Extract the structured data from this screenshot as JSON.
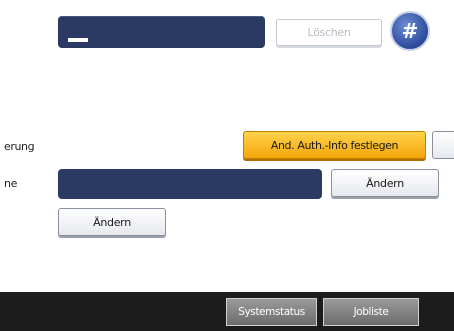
{
  "top": {
    "delete_label": "Löschen",
    "hash_label": "#"
  },
  "labels": {
    "row1": "erung",
    "row2": "ne"
  },
  "actions": {
    "auth_info_label": "And. Auth.-Info festlegen",
    "change_right_label": "Ändern",
    "change_left_label": "Ändern"
  },
  "bottom_bar": {
    "system_status_label": "Systemstatus",
    "job_list_label": "Jobliste"
  },
  "colors": {
    "field_fill": "#2b3a63",
    "highlight_button": "#f3a60b",
    "bottom_bar": "#1c1c1c"
  }
}
